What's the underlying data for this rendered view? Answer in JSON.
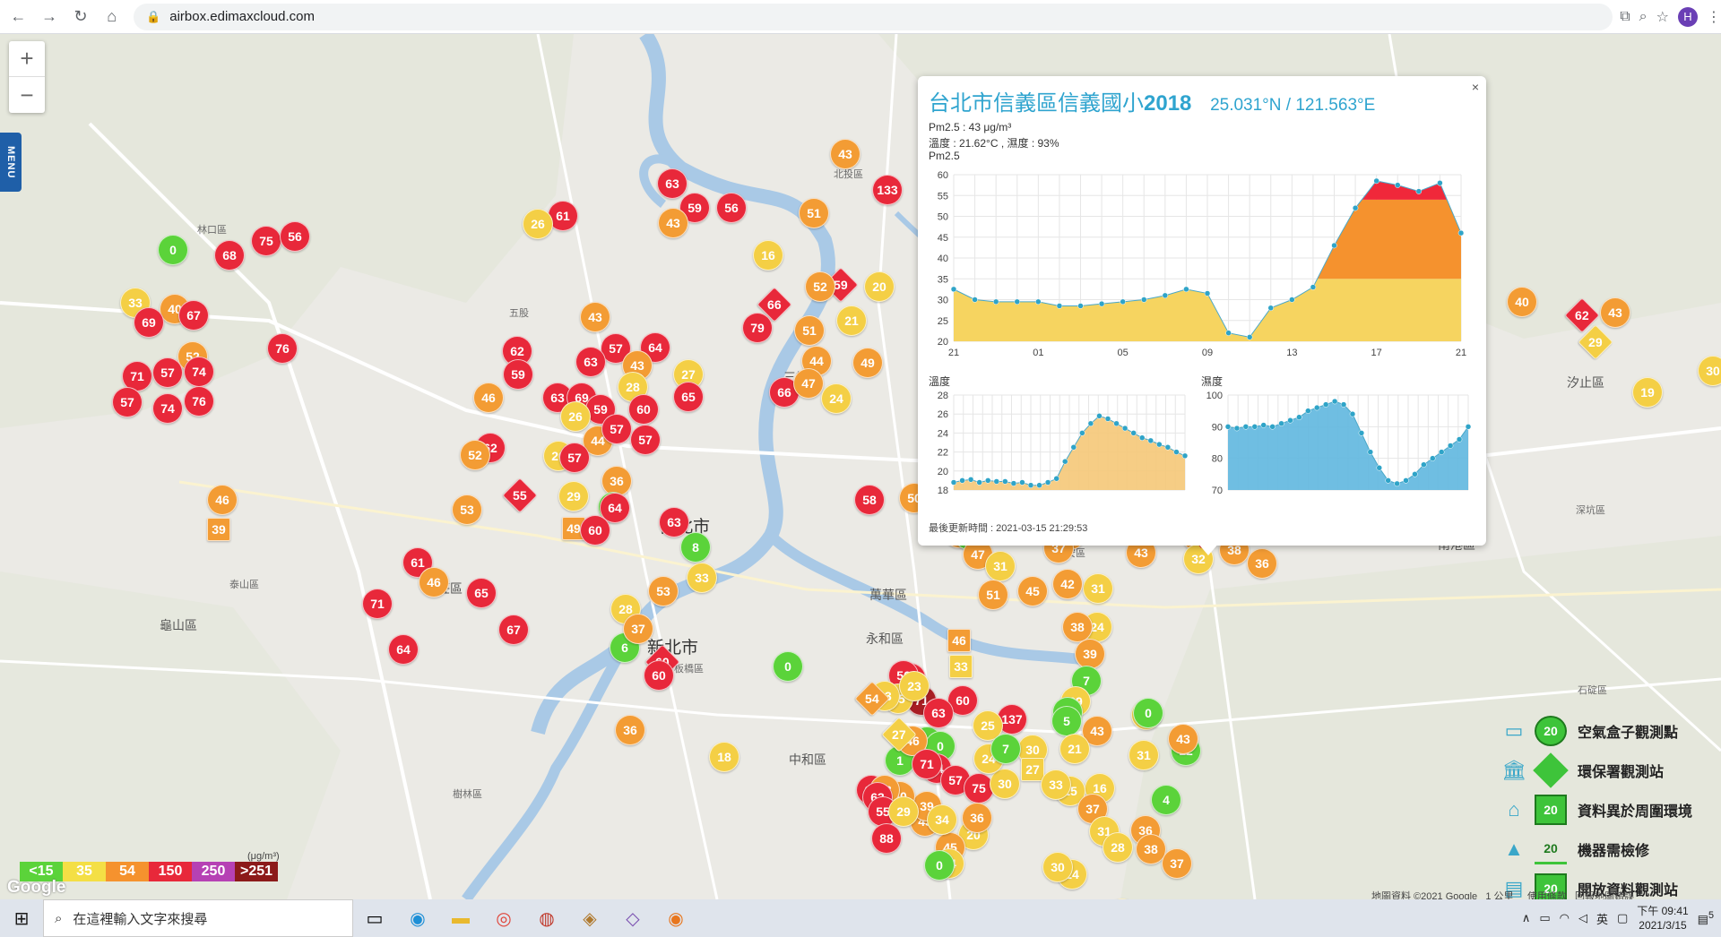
{
  "browser": {
    "url": "airbox.edimaxcloud.com",
    "profile_initial": "H"
  },
  "map": {
    "menu_label": "MENU",
    "places": [
      {
        "name": "台北市",
        "cls": "city"
      },
      {
        "name": "新北市",
        "cls": "city"
      },
      {
        "name": "新莊區",
        "cls": "big"
      },
      {
        "name": "三重區",
        "cls": "big"
      },
      {
        "name": "萬華區",
        "cls": "big"
      },
      {
        "name": "永和區",
        "cls": "big"
      },
      {
        "name": "中和區",
        "cls": "big"
      },
      {
        "name": "汐止區",
        "cls": "big"
      },
      {
        "name": "南港區",
        "cls": "big"
      },
      {
        "name": "龜山區",
        "cls": "big"
      },
      {
        "name": "林口區",
        "cls": ""
      },
      {
        "name": "五股",
        "cls": ""
      },
      {
        "name": "泰山區",
        "cls": ""
      },
      {
        "name": "樹林區",
        "cls": ""
      },
      {
        "name": "板橋區",
        "cls": ""
      },
      {
        "name": "北投區",
        "cls": ""
      },
      {
        "name": "石碇區",
        "cls": ""
      },
      {
        "name": "深坑區",
        "cls": ""
      },
      {
        "name": "大安區",
        "cls": ""
      },
      {
        "name": "信義區",
        "cls": ""
      }
    ],
    "markers": [
      {
        "v": "45",
        "c": "#f39c34"
      },
      {
        "v": "61",
        "c": "#e8283a"
      },
      {
        "v": "58",
        "c": "#e8283a"
      },
      {
        "v": "63",
        "c": "#e8283a"
      },
      {
        "v": "59",
        "c": "#e8283a"
      },
      {
        "v": "56",
        "c": "#e8283a"
      },
      {
        "v": "61",
        "c": "#e8283a"
      },
      {
        "v": "26",
        "c": "#f4cf45"
      },
      {
        "v": "43",
        "c": "#f39c34"
      },
      {
        "v": "43",
        "c": "#f39c34"
      },
      {
        "v": "133",
        "c": "#e8283a"
      },
      {
        "v": "51",
        "c": "#f39c34"
      },
      {
        "v": "16",
        "c": "#f4cf45"
      },
      {
        "v": "0",
        "c": "#5bd33a"
      },
      {
        "v": "68",
        "c": "#e8283a"
      },
      {
        "v": "75",
        "c": "#e8283a"
      },
      {
        "v": "56",
        "c": "#e8283a"
      },
      {
        "v": "33",
        "c": "#f4cf45"
      },
      {
        "v": "40",
        "c": "#f39c34"
      },
      {
        "v": "67",
        "c": "#e8283a"
      },
      {
        "v": "69",
        "c": "#e8283a"
      },
      {
        "v": "52",
        "c": "#f39c34"
      },
      {
        "v": "76",
        "c": "#e8283a"
      },
      {
        "v": "71",
        "c": "#e8283a"
      },
      {
        "v": "57",
        "c": "#e8283a"
      },
      {
        "v": "74",
        "c": "#e8283a"
      },
      {
        "v": "57",
        "c": "#e8283a"
      },
      {
        "v": "74",
        "c": "#e8283a"
      },
      {
        "v": "76",
        "c": "#e8283a"
      },
      {
        "v": "43",
        "c": "#f39c34"
      },
      {
        "v": "62",
        "c": "#e8283a"
      },
      {
        "v": "59",
        "c": "#e8283a"
      },
      {
        "v": "57",
        "c": "#e8283a"
      },
      {
        "v": "63",
        "c": "#e8283a"
      },
      {
        "v": "64",
        "c": "#e8283a"
      },
      {
        "v": "43",
        "c": "#f39c34"
      },
      {
        "v": "66",
        "c": "#e8283a",
        "s": "diamond"
      },
      {
        "v": "79",
        "c": "#e8283a"
      },
      {
        "v": "51",
        "c": "#f39c34"
      },
      {
        "v": "59",
        "c": "#e8283a",
        "s": "diamond"
      },
      {
        "v": "52",
        "c": "#f39c34"
      },
      {
        "v": "20",
        "c": "#f4cf45"
      },
      {
        "v": "21",
        "c": "#f4cf45"
      },
      {
        "v": "44",
        "c": "#f39c34"
      },
      {
        "v": "49",
        "c": "#f39c34"
      },
      {
        "v": "27",
        "c": "#f4cf45"
      },
      {
        "v": "28",
        "c": "#f4cf45"
      },
      {
        "v": "65",
        "c": "#e8283a"
      },
      {
        "v": "66",
        "c": "#e8283a"
      },
      {
        "v": "47",
        "c": "#f39c34"
      },
      {
        "v": "24",
        "c": "#f4cf45"
      },
      {
        "v": "46",
        "c": "#f39c34"
      },
      {
        "v": "63",
        "c": "#e8283a"
      },
      {
        "v": "69",
        "c": "#e8283a"
      },
      {
        "v": "59",
        "c": "#e8283a"
      },
      {
        "v": "60",
        "c": "#e8283a"
      },
      {
        "v": "26",
        "c": "#f4cf45"
      },
      {
        "v": "44",
        "c": "#f39c34"
      },
      {
        "v": "57",
        "c": "#e8283a"
      },
      {
        "v": "57",
        "c": "#e8283a"
      },
      {
        "v": "62",
        "c": "#e8283a"
      },
      {
        "v": "52",
        "c": "#f39c34"
      },
      {
        "v": "20",
        "c": "#f4cf45"
      },
      {
        "v": "57",
        "c": "#e8283a"
      },
      {
        "v": "36",
        "c": "#f39c34"
      },
      {
        "v": "55",
        "c": "#e8283a",
        "s": "diamond"
      },
      {
        "v": "29",
        "c": "#f4cf45"
      },
      {
        "v": "0",
        "c": "#5bd33a"
      },
      {
        "v": "53",
        "c": "#f39c34"
      },
      {
        "v": "64",
        "c": "#e8283a"
      },
      {
        "v": "49",
        "c": "#f39c34",
        "s": "square"
      },
      {
        "v": "60",
        "c": "#e8283a"
      },
      {
        "v": "63",
        "c": "#e8283a"
      },
      {
        "v": "8",
        "c": "#5bd33a"
      },
      {
        "v": "33",
        "c": "#f4cf45"
      },
      {
        "v": "53",
        "c": "#f39c34"
      },
      {
        "v": "46",
        "c": "#f39c34"
      },
      {
        "v": "39",
        "c": "#f39c34",
        "s": "square"
      },
      {
        "v": "61",
        "c": "#e8283a"
      },
      {
        "v": "46",
        "c": "#f39c34"
      },
      {
        "v": "71",
        "c": "#e8283a"
      },
      {
        "v": "64",
        "c": "#e8283a"
      },
      {
        "v": "65",
        "c": "#e8283a"
      },
      {
        "v": "67",
        "c": "#e8283a"
      },
      {
        "v": "28",
        "c": "#f4cf45"
      },
      {
        "v": "6",
        "c": "#5bd33a"
      },
      {
        "v": "37",
        "c": "#f39c34"
      },
      {
        "v": "60",
        "c": "#e8283a",
        "s": "diamond"
      },
      {
        "v": "60",
        "c": "#e8283a"
      },
      {
        "v": "0",
        "c": "#5bd33a"
      },
      {
        "v": "18",
        "c": "#f4cf45"
      },
      {
        "v": "36",
        "c": "#f39c34"
      },
      {
        "v": "58",
        "c": "#e8283a"
      },
      {
        "v": "50",
        "c": "#f39c34"
      },
      {
        "v": "44",
        "c": "#f39c34"
      },
      {
        "v": "49",
        "c": "#f39c34"
      },
      {
        "v": "15",
        "c": "#5bd33a"
      },
      {
        "v": "27",
        "c": "#f4cf45"
      },
      {
        "v": "53",
        "c": "#f39c34"
      },
      {
        "v": "47",
        "c": "#f39c34"
      },
      {
        "v": "31",
        "c": "#f4cf45"
      },
      {
        "v": "51",
        "c": "#f39c34"
      },
      {
        "v": "45",
        "c": "#f39c34"
      },
      {
        "v": "47",
        "c": "#f39c34"
      },
      {
        "v": "37",
        "c": "#f39c34"
      },
      {
        "v": "43",
        "c": "#f39c34"
      },
      {
        "v": "32",
        "c": "#f4cf45"
      },
      {
        "v": "1",
        "c": "#5bd33a"
      },
      {
        "v": "8",
        "c": "#5bd33a"
      },
      {
        "v": "43",
        "c": "#f39c34"
      },
      {
        "v": "32",
        "c": "#f4cf45"
      },
      {
        "v": "46",
        "c": "#f39c34"
      },
      {
        "v": "38",
        "c": "#f39c34"
      },
      {
        "v": "36",
        "c": "#f39c34"
      },
      {
        "v": "39",
        "c": "#f39c34"
      },
      {
        "v": "18",
        "c": "#f4cf45"
      },
      {
        "v": "40",
        "c": "#f39c34"
      },
      {
        "v": "29",
        "c": "#f4cf45",
        "s": "diamond"
      },
      {
        "v": "62",
        "c": "#e8283a",
        "s": "diamond"
      },
      {
        "v": "43",
        "c": "#f39c34"
      },
      {
        "v": "19",
        "c": "#f4cf45"
      },
      {
        "v": "30",
        "c": "#f4cf45"
      },
      {
        "v": "46",
        "c": "#f39c34",
        "s": "square"
      },
      {
        "v": "33",
        "c": "#f4cf45",
        "s": "square"
      },
      {
        "v": "31",
        "c": "#f4cf45"
      },
      {
        "v": "42",
        "c": "#f39c34"
      },
      {
        "v": "24",
        "c": "#f4cf45"
      },
      {
        "v": "38",
        "c": "#f39c34"
      },
      {
        "v": "39",
        "c": "#f39c34"
      },
      {
        "v": "7",
        "c": "#5bd33a"
      },
      {
        "v": "29",
        "c": "#f4cf45"
      },
      {
        "v": "0",
        "c": "#5bd33a"
      },
      {
        "v": "5",
        "c": "#5bd33a"
      },
      {
        "v": "137",
        "c": "#e8283a"
      },
      {
        "v": "43",
        "c": "#f39c34"
      },
      {
        "v": "21",
        "c": "#f4cf45"
      },
      {
        "v": "27",
        "c": "#f4cf45"
      },
      {
        "v": "0",
        "c": "#5bd33a"
      },
      {
        "v": "31",
        "c": "#f4cf45"
      },
      {
        "v": "4",
        "c": "#5bd33a"
      },
      {
        "v": "12",
        "c": "#5bd33a"
      },
      {
        "v": "43",
        "c": "#f39c34"
      },
      {
        "v": "16",
        "c": "#f4cf45"
      },
      {
        "v": "25",
        "c": "#f4cf45"
      },
      {
        "v": "37",
        "c": "#f39c34"
      },
      {
        "v": "31",
        "c": "#f4cf45"
      },
      {
        "v": "28",
        "c": "#f4cf45"
      },
      {
        "v": "36",
        "c": "#f39c34"
      },
      {
        "v": "38",
        "c": "#f39c34"
      },
      {
        "v": "37",
        "c": "#f39c34"
      },
      {
        "v": "33",
        "c": "#f4cf45"
      },
      {
        "v": "24",
        "c": "#f4cf45"
      },
      {
        "v": "30",
        "c": "#f4cf45"
      },
      {
        "v": "20",
        "c": "#f4cf45"
      },
      {
        "v": "45",
        "c": "#f39c34"
      },
      {
        "v": "34",
        "c": "#f4cf45"
      },
      {
        "v": "0",
        "c": "#5bd33a"
      },
      {
        "v": "43",
        "c": "#f39c34"
      },
      {
        "v": "39",
        "c": "#f39c34"
      },
      {
        "v": "50",
        "c": "#f39c34"
      },
      {
        "v": "1",
        "c": "#5bd33a"
      },
      {
        "v": "0",
        "c": "#5bd33a"
      },
      {
        "v": "0",
        "c": "#5bd33a"
      },
      {
        "v": "60",
        "c": "#e8283a"
      },
      {
        "v": "71",
        "c": "#a81e23"
      },
      {
        "v": "63",
        "c": "#e8283a"
      },
      {
        "v": "65",
        "c": "#e8283a"
      },
      {
        "v": "56",
        "c": "#e8283a"
      },
      {
        "v": "25",
        "c": "#f4cf45"
      },
      {
        "v": "33",
        "c": "#f4cf45"
      },
      {
        "v": "54",
        "c": "#f39c34",
        "s": "diamond"
      },
      {
        "v": "63",
        "c": "#e8283a"
      },
      {
        "v": "53",
        "c": "#f39c34"
      },
      {
        "v": "63",
        "c": "#e8283a"
      },
      {
        "v": "55",
        "c": "#e8283a"
      },
      {
        "v": "88",
        "c": "#e8283a"
      },
      {
        "v": "84",
        "c": "#e8283a"
      },
      {
        "v": "46",
        "c": "#f39c34"
      },
      {
        "v": "71",
        "c": "#e8283a"
      },
      {
        "v": "57",
        "c": "#e8283a"
      },
      {
        "v": "75",
        "c": "#e8283a"
      },
      {
        "v": "30",
        "c": "#f4cf45"
      },
      {
        "v": "30",
        "c": "#f4cf45"
      },
      {
        "v": "24",
        "c": "#f4cf45"
      },
      {
        "v": "36",
        "c": "#f39c34"
      },
      {
        "v": "23",
        "c": "#f4cf45"
      },
      {
        "v": "29",
        "c": "#f4cf45"
      },
      {
        "v": "27",
        "c": "#f4cf45",
        "s": "diamond"
      },
      {
        "v": "34",
        "c": "#f4cf45"
      },
      {
        "v": "25",
        "c": "#f4cf45"
      },
      {
        "v": "7",
        "c": "#5bd33a"
      },
      {
        "v": "27",
        "c": "#f4cf45",
        "s": "square"
      },
      {
        "v": "33",
        "c": "#f4cf45"
      },
      {
        "v": "24",
        "c": "#f4cf45"
      },
      {
        "v": "38",
        "c": "#f39c34"
      },
      {
        "v": "45",
        "c": "#f39c34"
      },
      {
        "v": "20",
        "c": "#f4cf45"
      },
      {
        "v": "36",
        "c": "#f39c34"
      },
      {
        "v": "39",
        "c": "#f39c34"
      },
      {
        "v": "46",
        "c": "#f39c34"
      },
      {
        "v": "36",
        "c": "#f39c34"
      },
      {
        "v": "38",
        "c": "#f39c34"
      },
      {
        "v": "39",
        "c": "#f39c34"
      },
      {
        "v": "18",
        "c": "#f4cf45"
      },
      {
        "v": "40",
        "c": "#f39c34"
      },
      {
        "v": "47",
        "c": "#f39c34"
      },
      {
        "v": "32",
        "c": "#f4cf45"
      },
      {
        "v": "65",
        "c": "#e8283a"
      },
      {
        "v": "62",
        "c": "#e8283a"
      }
    ]
  },
  "popup": {
    "close": "×",
    "station_name": "台北市信義區信義國小",
    "station_year": "2018",
    "coords": "25.031°N / 121.563°E",
    "pm_line": "Pm2.5 : 43 μg/m³",
    "temp_line": "溫度 : 21.62°C , 濕度 : 93%",
    "pm_title": "Pm2.5",
    "temp_title": "溫度",
    "hum_title": "濕度",
    "updated": "最後更新時間 : 2021-03-15 21:29:53"
  },
  "chart_data": [
    {
      "type": "area",
      "title": "Pm2.5",
      "x": [
        "21",
        "22",
        "23",
        "00",
        "01",
        "02",
        "03",
        "04",
        "05",
        "06",
        "07",
        "08",
        "09",
        "10",
        "11",
        "12",
        "13",
        "14",
        "15",
        "16",
        "17",
        "18",
        "19",
        "20",
        "21"
      ],
      "x_ticks": [
        "21",
        "01",
        "05",
        "09",
        "13",
        "17",
        "21"
      ],
      "values": [
        32.5,
        30,
        29.5,
        29.5,
        29.5,
        28.5,
        28.5,
        29,
        29.5,
        30,
        31,
        32.5,
        31.5,
        22,
        21,
        28,
        30,
        33,
        43,
        52,
        58.5,
        57.5,
        56,
        58,
        46
      ],
      "ylim": [
        20,
        60
      ],
      "y_ticks": [
        20,
        25,
        30,
        35,
        40,
        45,
        50,
        55,
        60
      ],
      "bands": [
        {
          "from": 0,
          "to": 35,
          "color": "#f6d460"
        },
        {
          "from": 35,
          "to": 54,
          "color": "#f5922e"
        },
        {
          "from": 54,
          "to": 150,
          "color": "#f0283a"
        }
      ]
    },
    {
      "type": "area",
      "title": "溫度",
      "values": [
        18.8,
        19,
        19.1,
        18.8,
        19,
        18.9,
        18.9,
        18.7,
        18.8,
        18.5,
        18.5,
        18.8,
        19.2,
        21,
        22.5,
        24,
        25,
        25.8,
        25.5,
        25,
        24.5,
        24,
        23.5,
        23.2,
        22.8,
        22.5,
        22,
        21.6
      ],
      "ylim": [
        18,
        28
      ],
      "y_ticks": [
        18,
        20,
        22,
        24,
        26,
        28
      ],
      "color": "#f5c878"
    },
    {
      "type": "area",
      "title": "濕度",
      "values": [
        90,
        89.5,
        90,
        90,
        90.5,
        90,
        91,
        92,
        93,
        95,
        96,
        97,
        98,
        97,
        94,
        88,
        82,
        77,
        73,
        72,
        73,
        75,
        78,
        80,
        82,
        84,
        86,
        90
      ],
      "ylim": [
        70,
        100
      ],
      "y_ticks": [
        70,
        80,
        90,
        100
      ],
      "color": "#5fb7df"
    }
  ],
  "scale": {
    "unit": "(μg/m³)",
    "cells": [
      {
        "label": "<15",
        "color": "#5bd33a"
      },
      {
        "label": "35",
        "color": "#f4df45"
      },
      {
        "label": "54",
        "color": "#f5922e"
      },
      {
        "label": "150",
        "color": "#e8283a"
      },
      {
        "label": "250",
        "color": "#b641b4"
      },
      {
        "label": ">251",
        "color": "#8c1a1a"
      }
    ]
  },
  "station_legend": [
    {
      "label": "空氣盒子觀測點",
      "icon": "monitor-icon",
      "shape": "circle",
      "badge": "20"
    },
    {
      "label": "環保署觀測站",
      "icon": "building-icon",
      "shape": "diamond",
      "badge": "20"
    },
    {
      "label": "資料異於周圍環境",
      "icon": "house-icon",
      "shape": "square",
      "badge": "20"
    },
    {
      "label": "機器需檢修",
      "icon": "tower-icon",
      "shape": "triangle",
      "badge": "20"
    },
    {
      "label": "開放資料觀測站",
      "icon": "box-icon",
      "shape": "square",
      "badge": "20"
    }
  ],
  "attribution": {
    "google": "Google",
    "map_data": "地圖資料 ©2021 Google",
    "scale_label": "1 公里",
    "terms": "使用條款",
    "report": "回報地圖錯誤"
  },
  "taskbar": {
    "search_placeholder": "在這裡輸入文字來搜尋",
    "ime": "英",
    "time_period": "下午 09:41",
    "date": "2021/3/15",
    "notif_count": "5"
  }
}
